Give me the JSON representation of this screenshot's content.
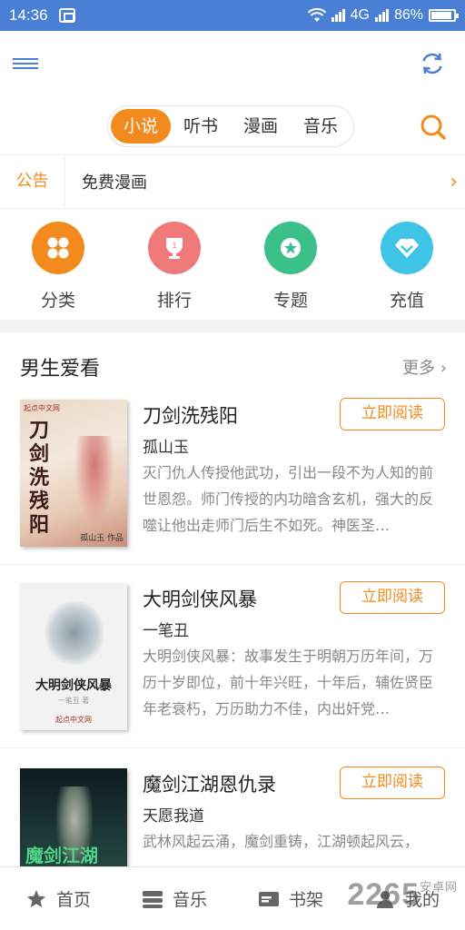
{
  "status_bar": {
    "time": "14:36",
    "network": "4G",
    "battery": "86%"
  },
  "top_tabs": [
    {
      "label": "小说",
      "active": true
    },
    {
      "label": "听书",
      "active": false
    },
    {
      "label": "漫画",
      "active": false
    },
    {
      "label": "音乐",
      "active": false
    }
  ],
  "notice": {
    "tag": "公告",
    "text": "免费漫画",
    "arrow": "›"
  },
  "categories": [
    {
      "label": "分类",
      "color": "#f28a1e",
      "icon": "grid-icon"
    },
    {
      "label": "排行",
      "color": "#f07a7a",
      "icon": "trophy-icon"
    },
    {
      "label": "专题",
      "color": "#3cc08a",
      "icon": "star-icon"
    },
    {
      "label": "充值",
      "color": "#3fc3e6",
      "icon": "diamond-icon"
    }
  ],
  "section": {
    "title": "男生爱看",
    "more": "更多 ›"
  },
  "books": [
    {
      "title": "刀剑洗残阳",
      "author": "孤山玉",
      "desc": "灭门仇人传授他武功，引出一段不为人知的前世恩怨。师门传授的内功暗含玄机，强大的反噬让他出走师门后生不如死。神医圣…",
      "button": "立即阅读",
      "cover_text": "刀剑洗残阳",
      "cover_publisher": "起点中文网",
      "cover_author_sig": "孤山玉 作品"
    },
    {
      "title": "大明剑侠风暴",
      "author": "一笔丑",
      "desc": "大明剑侠风暴：故事发生于明朝万历年间，万历十岁即位，前十年兴旺，十年后，辅佐贤臣年老衰朽，万历助力不佳，内出奸党…",
      "button": "立即阅读",
      "cover_text": "大明剑侠风暴",
      "cover_publisher": "起点中文网",
      "cover_author_sig": "一笔丑 著"
    },
    {
      "title": "魔剑江湖恩仇录",
      "author": "天愿我道",
      "desc": "武林风起云涌，魔剑重铸，江湖顿起风云，",
      "button": "立即阅读",
      "cover_text": "魔剑江湖"
    }
  ],
  "bottom_nav": [
    {
      "label": "首页",
      "icon": "star-icon"
    },
    {
      "label": "音乐",
      "icon": "music-icon"
    },
    {
      "label": "书架",
      "icon": "bookshelf-icon"
    },
    {
      "label": "我的",
      "icon": "user-icon"
    }
  ],
  "watermark": {
    "text": "2265",
    "suffix": "安卓网"
  },
  "colors": {
    "accent": "#f28a1e",
    "status_bar": "#4a7fd6"
  }
}
